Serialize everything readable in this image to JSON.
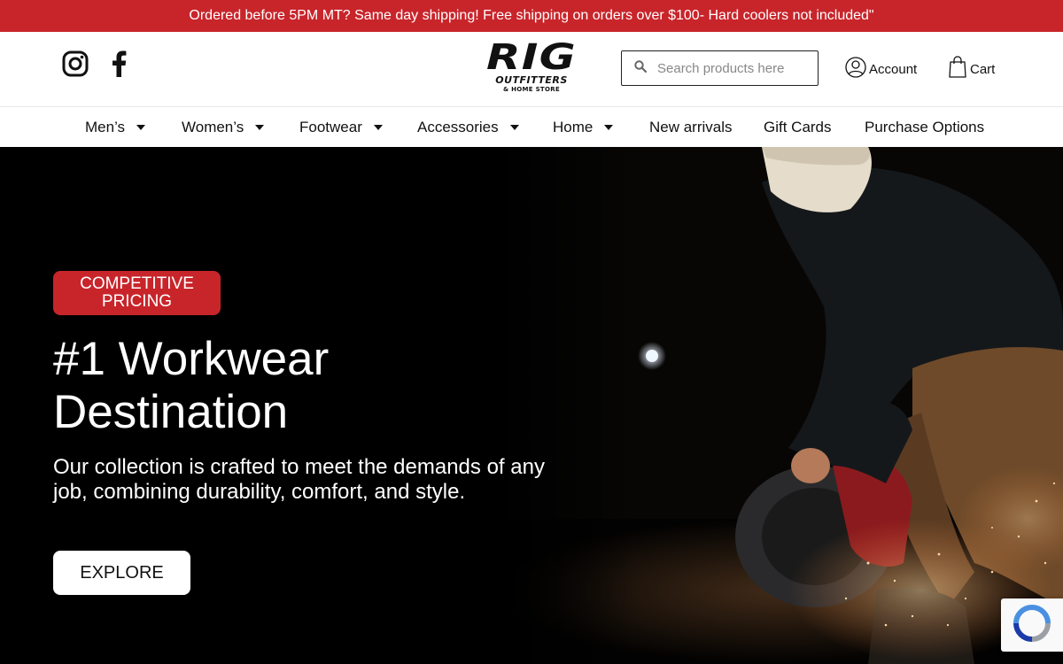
{
  "announcement": "Ordered before 5PM MT? Same day shipping! Free shipping on orders over $100- Hard coolers not included\"",
  "social": {
    "instagram_icon": "instagram-icon",
    "facebook_icon": "facebook-icon"
  },
  "logo": {
    "main": "RIG",
    "sub": "OUTFITTERS",
    "sub2": "& HOME STORE"
  },
  "search": {
    "placeholder": "Search products here",
    "icon": "search-icon"
  },
  "header_links": {
    "account": "Account",
    "cart": "Cart"
  },
  "nav": {
    "items": [
      {
        "label": "Men’s",
        "dropdown": true
      },
      {
        "label": "Women’s",
        "dropdown": true
      },
      {
        "label": "Footwear",
        "dropdown": true
      },
      {
        "label": "Accessories",
        "dropdown": true
      },
      {
        "label": "Home",
        "dropdown": true
      },
      {
        "label": "New arrivals",
        "dropdown": false
      },
      {
        "label": "Gift Cards",
        "dropdown": false
      },
      {
        "label": "Purchase Options",
        "dropdown": false
      }
    ]
  },
  "hero": {
    "badge": "COMPETITIVE PRICING",
    "headline": "#1 Workwear Destination",
    "subtext": "Our collection is crafted to meet the demands of any job, combining durability, comfort, and style.",
    "cta": "EXPLORE"
  },
  "colors": {
    "brand_red": "#c8252b",
    "text_dark": "#111111",
    "hero_bg": "#000000"
  }
}
